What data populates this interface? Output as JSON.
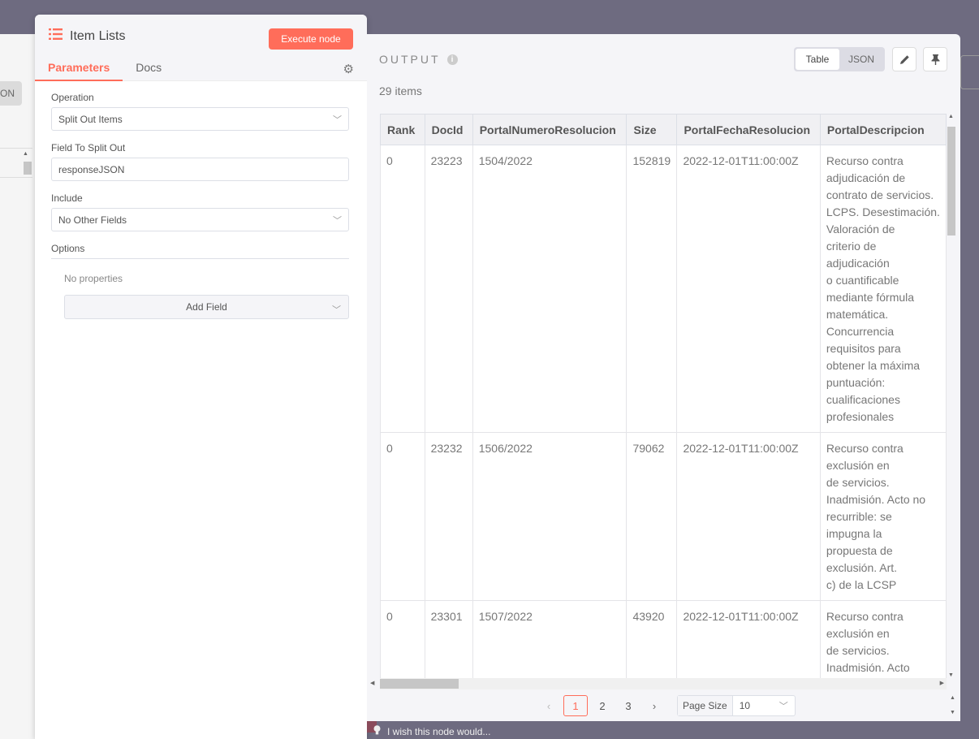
{
  "left_panel": {
    "json_label": "JSON"
  },
  "node": {
    "title": "Item Lists",
    "execute_label": "Execute node",
    "tabs": [
      "Parameters",
      "Docs"
    ],
    "operation_label": "Operation",
    "operation_value": "Split Out Items",
    "field_split_label": "Field To Split Out",
    "field_split_value": "responseJSON",
    "include_label": "Include",
    "include_value": "No Other Fields",
    "options_label": "Options",
    "no_properties": "No properties",
    "add_field": "Add Field"
  },
  "output": {
    "title": "OUTPUT",
    "view_table": "Table",
    "view_json": "JSON",
    "items_count": "29 items",
    "columns": [
      "Rank",
      "DocId",
      "PortalNumeroResolucion",
      "Size",
      "PortalFechaResolucion",
      "PortalDescripcion"
    ],
    "rows": [
      [
        "0",
        "23223",
        "1504/2022",
        "152819",
        "2022-12-01T11:00:00Z",
        "Recurso contra\nadjudicación de\ncontrato de servicios.\nLCPS. Desestimación.\nValoración de\ncriterio de\nadjudicación\no cuantificable\nmediante fórmula\nmatemática.\nConcurrencia\nrequisitos para\nobtener la máxima\npuntuación:\ncualificaciones\nprofesionales"
      ],
      [
        "0",
        "23232",
        "1506/2022",
        "79062",
        "2022-12-01T11:00:00Z",
        "Recurso contra\nexclusión en\nde servicios.\nInadmisión. Acto no\nrecurrible: se\nimpugna la\npropuesta de\nexclusión. Art.\nc) de la LCSP"
      ],
      [
        "0",
        "23301",
        "1507/2022",
        "43920",
        "2022-12-01T11:00:00Z",
        "Recurso contra\nexclusión en\nde servicios.\nInadmisión. Acto"
      ]
    ],
    "pagination": {
      "pages": [
        "1",
        "2",
        "3"
      ],
      "current": "1",
      "page_size_label": "Page Size",
      "page_size_value": "10"
    }
  },
  "footer": {
    "wish_text": "I wish this node would..."
  }
}
